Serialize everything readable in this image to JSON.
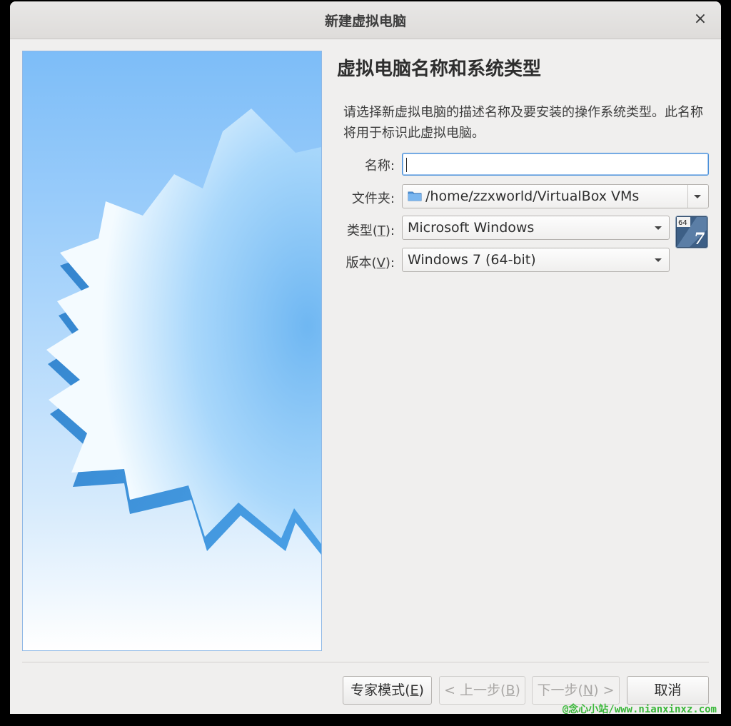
{
  "window": {
    "title": "新建虚拟电脑",
    "close_glyph": "×"
  },
  "page": {
    "heading": "虚拟电脑名称和系统类型",
    "description": "请选择新虚拟电脑的描述名称及要安装的操作系统类型。此名称将用于标识此虚拟电脑。"
  },
  "form": {
    "name": {
      "label": "名称:",
      "value": ""
    },
    "folder": {
      "label": "文件夹:",
      "value": "/home/zzxworld/VirtualBox VMs",
      "icon": "folder-icon"
    },
    "type": {
      "label_prefix": "类型(",
      "label_key": "T",
      "label_suffix": "):",
      "value": "Microsoft Windows"
    },
    "version": {
      "label_prefix": "版本(",
      "label_key": "V",
      "label_suffix": "):",
      "value": "Windows 7 (64-bit)"
    },
    "os_badge": {
      "arch": "64",
      "number": "7",
      "icon": "windows-7-64bit-icon"
    }
  },
  "buttons": {
    "expert": {
      "prefix": "专家模式(",
      "key": "E",
      "suffix": ")"
    },
    "back": {
      "prefix": "< 上一步(",
      "key": "B",
      "suffix": ")"
    },
    "next": {
      "prefix": "下一步(",
      "key": "N",
      "suffix": ") >"
    },
    "cancel": "取消"
  },
  "watermark": "@念心小站/www.nianxinxz.com",
  "colors": {
    "accent": "#4a90d9",
    "sky_top": "#7dbdf8",
    "star_blue": "#3f8fd6",
    "watermark": "#3ab83a"
  }
}
